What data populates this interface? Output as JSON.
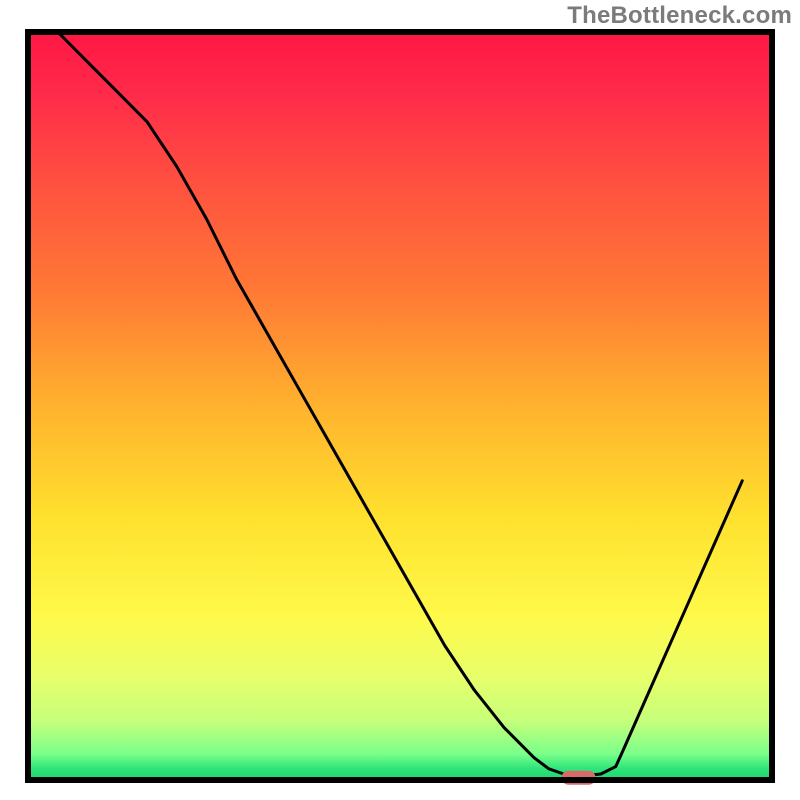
{
  "watermark": "TheBottleneck.com",
  "chart_data": {
    "type": "line",
    "title": "",
    "xlabel": "",
    "ylabel": "",
    "xlim": [
      0,
      100
    ],
    "ylim": [
      0,
      100
    ],
    "x": [
      4,
      8,
      12,
      16,
      20,
      24,
      28,
      32,
      36,
      40,
      44,
      48,
      52,
      56,
      60,
      64,
      68,
      70,
      72,
      73.5,
      75,
      77,
      79,
      80,
      84,
      88,
      92,
      96
    ],
    "y": [
      100,
      96,
      92,
      88,
      82,
      75,
      67,
      60,
      53,
      46,
      39,
      32,
      25,
      18,
      12,
      7,
      3,
      1.5,
      0.8,
      0.6,
      0.6,
      0.8,
      1.8,
      4,
      13,
      22,
      31,
      40
    ],
    "marker": {
      "x": 74,
      "y": 0.3,
      "color": "#d96a6a"
    },
    "gradient_stops": [
      {
        "offset": 0.0,
        "color": "#ff1744"
      },
      {
        "offset": 0.08,
        "color": "#ff2a4a"
      },
      {
        "offset": 0.2,
        "color": "#ff5040"
      },
      {
        "offset": 0.35,
        "color": "#ff7a35"
      },
      {
        "offset": 0.5,
        "color": "#ffb22e"
      },
      {
        "offset": 0.65,
        "color": "#ffe12e"
      },
      {
        "offset": 0.78,
        "color": "#fff94a"
      },
      {
        "offset": 0.86,
        "color": "#e8ff6a"
      },
      {
        "offset": 0.92,
        "color": "#c7ff7a"
      },
      {
        "offset": 0.965,
        "color": "#7aff8a"
      },
      {
        "offset": 0.985,
        "color": "#2fe47a"
      },
      {
        "offset": 1.0,
        "color": "#1cd66e"
      }
    ],
    "axis_color": "#000000",
    "curve_color": "#000000"
  }
}
